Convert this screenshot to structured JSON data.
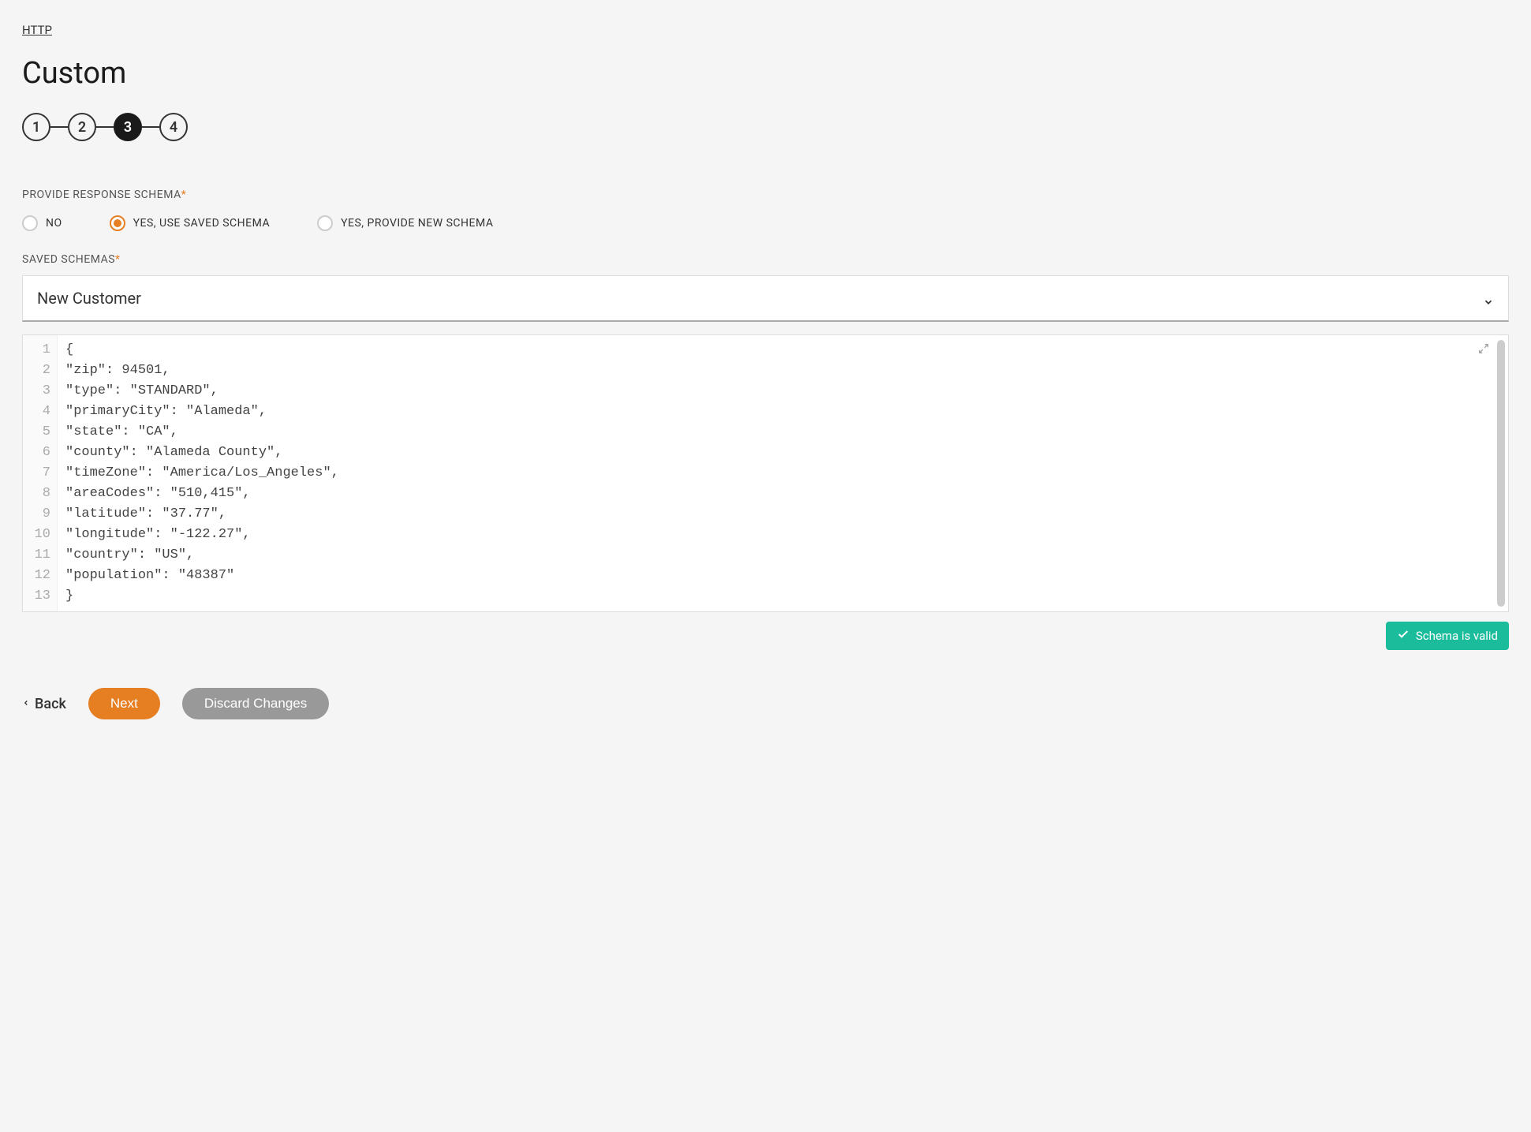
{
  "breadcrumb": "HTTP",
  "page_title": "Custom",
  "stepper": {
    "steps": [
      "1",
      "2",
      "3",
      "4"
    ],
    "active_index": 2
  },
  "form": {
    "response_schema_label": "PROVIDE RESPONSE SCHEMA",
    "required_mark": "*",
    "radio_options": {
      "no": "NO",
      "yes_saved": "YES, USE SAVED SCHEMA",
      "yes_new": "YES, PROVIDE NEW SCHEMA",
      "selected": "yes_saved"
    },
    "saved_schemas_label": "SAVED SCHEMAS",
    "dropdown_value": "New Customer"
  },
  "code": {
    "lines": [
      "{",
      "\"zip\": 94501,",
      "\"type\": \"STANDARD\",",
      "\"primaryCity\": \"Alameda\",",
      "\"state\": \"CA\",",
      "\"county\": \"Alameda County\",",
      "\"timeZone\": \"America/Los_Angeles\",",
      "\"areaCodes\": \"510,415\",",
      "\"latitude\": \"37.77\",",
      "\"longitude\": \"-122.27\",",
      "\"country\": \"US\",",
      "\"population\": \"48387\"",
      "}"
    ]
  },
  "validation": {
    "message": "Schema is valid"
  },
  "actions": {
    "back": "Back",
    "next": "Next",
    "discard": "Discard Changes"
  }
}
